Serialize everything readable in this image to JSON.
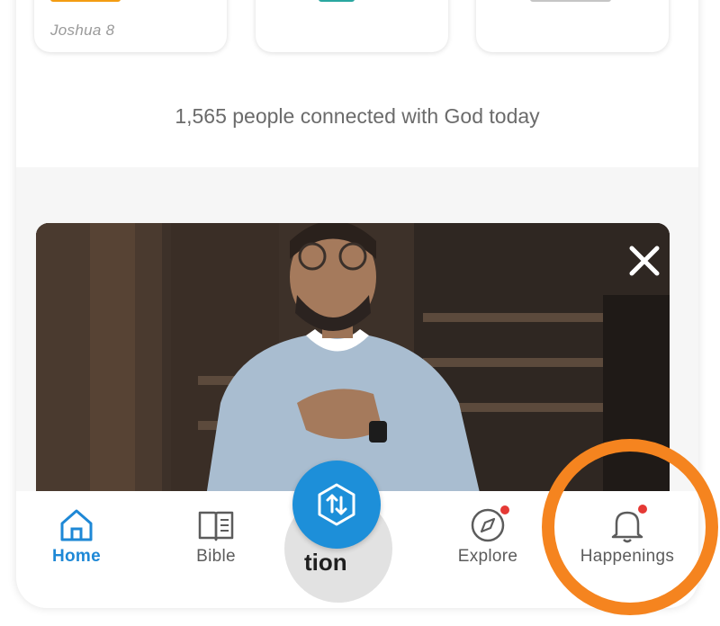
{
  "cards": [
    {
      "reference": "Joshua 8",
      "peek_color": "#f39c12"
    },
    {
      "reference": "",
      "peek_color": "#2aa7a0"
    },
    {
      "reference": "",
      "peek_color": "#9e9e9e"
    }
  ],
  "connected_text": "1,565 people connected with God today",
  "video": {
    "close_icon": "close-icon"
  },
  "fab": {
    "icon": "cycle-arrows-icon",
    "under_text": "tion"
  },
  "tabs": [
    {
      "label": "Home",
      "icon": "home-icon",
      "active": true,
      "badge": false
    },
    {
      "label": "Bible",
      "icon": "book-icon",
      "active": false,
      "badge": false
    },
    {
      "label": "Explore",
      "icon": "compass-icon",
      "active": false,
      "badge": true
    },
    {
      "label": "Happenings",
      "icon": "bell-icon",
      "active": false,
      "badge": true
    }
  ],
  "colors": {
    "accent": "#1e88d6",
    "badge": "#e53935",
    "highlight": "#f5841f",
    "fab": "#1d8fd9"
  }
}
